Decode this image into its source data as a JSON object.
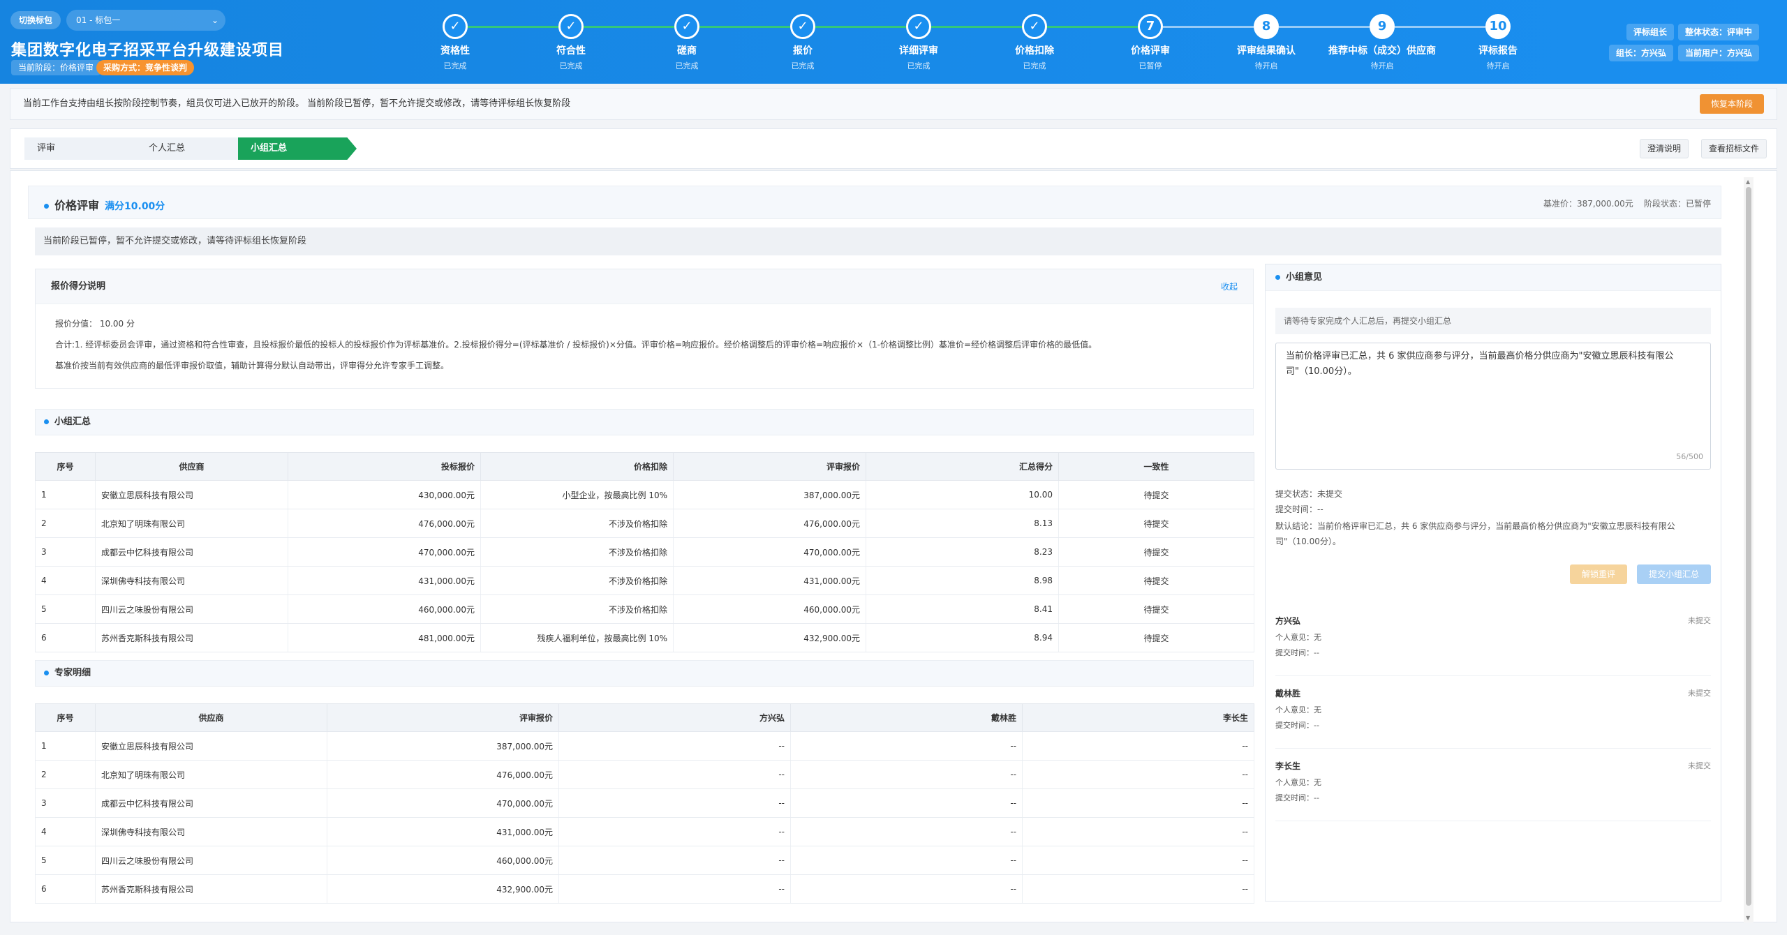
{
  "header": {
    "switch_label": "切换标包",
    "package_value": "01 - 标包一",
    "title": "集团数字化电子招采平台升级建设项目",
    "current_stage": "当前阶段：价格评审",
    "procurement_method": "采购方式：竞争性谈判",
    "role_tag": "评标组长",
    "overall_status": "整体状态：评审中",
    "leader": "组长：方兴弘",
    "current_user": "当前用户：方兴弘"
  },
  "steps": [
    {
      "num": "1",
      "name": "资格性",
      "status": "已完成",
      "state": "done"
    },
    {
      "num": "2",
      "name": "符合性",
      "status": "已完成",
      "state": "done"
    },
    {
      "num": "3",
      "name": "磋商",
      "status": "已完成",
      "state": "done"
    },
    {
      "num": "4",
      "name": "报价",
      "status": "已完成",
      "state": "done"
    },
    {
      "num": "5",
      "name": "详细评审",
      "status": "已完成",
      "state": "done"
    },
    {
      "num": "6",
      "name": "价格扣除",
      "status": "已完成",
      "state": "done"
    },
    {
      "num": "7",
      "name": "价格评审",
      "status": "已暂停",
      "state": "current"
    },
    {
      "num": "8",
      "name": "评审结果确认",
      "status": "待开启",
      "state": "future"
    },
    {
      "num": "9",
      "name": "推荐中标（成交）供应商",
      "status": "待开启",
      "state": "future"
    },
    {
      "num": "10",
      "name": "评标报告",
      "status": "待开启",
      "state": "future"
    }
  ],
  "notice": {
    "text": "当前工作台支持由组长按阶段控制节奏，组员仅可进入已放开的阶段。 当前阶段已暂停，暂不允许提交或修改，请等待评标组长恢复阶段",
    "restore_button": "恢复本阶段"
  },
  "tabs": [
    "评审",
    "个人汇总",
    "小组汇总"
  ],
  "tab_buttons": {
    "clarify": "澄清说明",
    "view_doc": "查看招标文件"
  },
  "section": {
    "title": "价格评审",
    "full_score": "满分10.00分",
    "base_price": "基准价：387,000.00元",
    "stage_status": "阶段状态：已暂停",
    "paused_text": "当前阶段已暂停，暂不允许提交或修改，请等待评标组长恢复阶段"
  },
  "explain": {
    "title": "报价得分说明",
    "collapse": "收起",
    "line1": "报价分值： 10.00 分",
    "line2": "合计:1. 经评标委员会评审，通过资格和符合性审查，且投标报价最低的投标人的投标报价作为评标基准价。2.投标报价得分=(评标基准价 / 投标报价)×分值。评审价格=响应报价。经价格调整后的评审价格=响应报价×（1-价格调整比例）基准价=经价格调整后评审价格的最低值。",
    "line3": "基准价按当前有效供应商的最低评审报价取值，辅助计算得分默认自动带出，评审得分允许专家手工调整。"
  },
  "group_summary": {
    "title": "小组汇总",
    "headers": [
      "序号",
      "供应商",
      "投标报价",
      "价格扣除",
      "评审报价",
      "汇总得分",
      "一致性"
    ],
    "rows": [
      [
        "1",
        "安徽立思辰科技有限公司",
        "430,000.00元",
        "小型企业，按最高比例 10%",
        "387,000.00元",
        "10.00",
        "待提交"
      ],
      [
        "2",
        "北京知了明珠有限公司",
        "476,000.00元",
        "不涉及价格扣除",
        "476,000.00元",
        "8.13",
        "待提交"
      ],
      [
        "3",
        "成都云中忆科技有限公司",
        "470,000.00元",
        "不涉及价格扣除",
        "470,000.00元",
        "8.23",
        "待提交"
      ],
      [
        "4",
        "深圳佛寺科技有限公司",
        "431,000.00元",
        "不涉及价格扣除",
        "431,000.00元",
        "8.98",
        "待提交"
      ],
      [
        "5",
        "四川云之味股份有限公司",
        "460,000.00元",
        "不涉及价格扣除",
        "460,000.00元",
        "8.41",
        "待提交"
      ],
      [
        "6",
        "苏州香克斯科技有限公司",
        "481,000.00元",
        "残疾人福利单位，按最高比例 10%",
        "432,900.00元",
        "8.94",
        "待提交"
      ]
    ]
  },
  "expert_detail": {
    "title": "专家明细",
    "headers": [
      "序号",
      "供应商",
      "评审报价",
      "方兴弘",
      "戴林胜",
      "李长生"
    ],
    "rows": [
      [
        "1",
        "安徽立思辰科技有限公司",
        "387,000.00元",
        "--",
        "--",
        "--"
      ],
      [
        "2",
        "北京知了明珠有限公司",
        "476,000.00元",
        "--",
        "--",
        "--"
      ],
      [
        "3",
        "成都云中忆科技有限公司",
        "470,000.00元",
        "--",
        "--",
        "--"
      ],
      [
        "4",
        "深圳佛寺科技有限公司",
        "431,000.00元",
        "--",
        "--",
        "--"
      ],
      [
        "5",
        "四川云之味股份有限公司",
        "460,000.00元",
        "--",
        "--",
        "--"
      ],
      [
        "6",
        "苏州香克斯科技有限公司",
        "432,900.00元",
        "--",
        "--",
        "--"
      ]
    ]
  },
  "opinion": {
    "title": "小组意见",
    "wait_text": "请等待专家完成个人汇总后，再提交小组汇总",
    "textarea_value": "当前价格评审已汇总，共 6 家供应商参与评分，当前最高价格分供应商为\"安徽立思辰科技有限公司\"（10.00分）。",
    "counter": "56/500",
    "submit_status": "提交状态：未提交",
    "submit_time": "提交时间：--",
    "default_conclusion": "默认结论：当前价格评审已汇总，共 6 家供应商参与评分，当前最高价格分供应商为\"安徽立思辰科技有限公司\"（10.00分）。",
    "unlock_button": "解锁重评",
    "submit_button": "提交小组汇总",
    "experts": [
      {
        "name": "方兴弘",
        "status": "未提交",
        "opinion": "个人意见：无",
        "time": "提交时间：--"
      },
      {
        "name": "戴林胜",
        "status": "未提交",
        "opinion": "个人意见：无",
        "time": "提交时间：--"
      },
      {
        "name": "李长生",
        "status": "未提交",
        "opinion": "个人意见：无",
        "time": "提交时间：--"
      }
    ]
  },
  "colors": {
    "primary": "#1a8ff0",
    "success": "#19a35a",
    "warning": "#f09233",
    "danger": "#e74c3c"
  }
}
